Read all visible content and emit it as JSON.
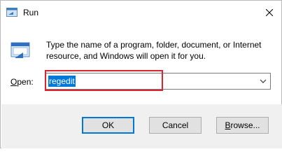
{
  "window": {
    "title": "Run",
    "title_icon": "run-icon",
    "close_icon": "close-icon"
  },
  "body": {
    "app_icon": "run-app-icon",
    "message": "Type the name of a program, folder, document, or Internet resource, and Windows will open it for you."
  },
  "open_field": {
    "label_mnemonic": "O",
    "label_rest": "pen:",
    "value": "regedit",
    "dropdown_icon": "chevron-down-icon"
  },
  "buttons": {
    "ok": "OK",
    "cancel": "Cancel",
    "browse_mnemonic": "B",
    "browse_rest": "rowse..."
  },
  "colors": {
    "selection": "#0078d7",
    "highlight_box": "#d9232d",
    "footer_bg": "#f0f0f0"
  }
}
